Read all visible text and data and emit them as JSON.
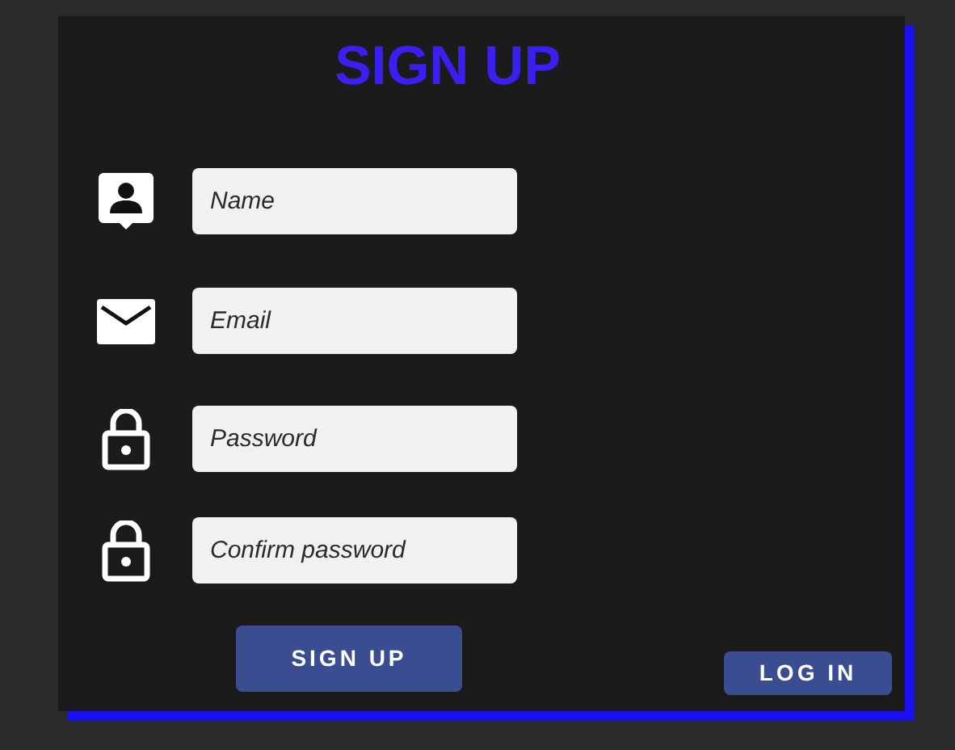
{
  "title": "SIGN UP",
  "fields": [
    {
      "kind": "person",
      "placeholder": "Name"
    },
    {
      "kind": "mail",
      "placeholder": "Email"
    },
    {
      "kind": "lock",
      "placeholder": "Password"
    },
    {
      "kind": "lock",
      "placeholder": "Confirm password"
    }
  ],
  "submit_button": "SIGN UP",
  "login_button": "LOG IN"
}
